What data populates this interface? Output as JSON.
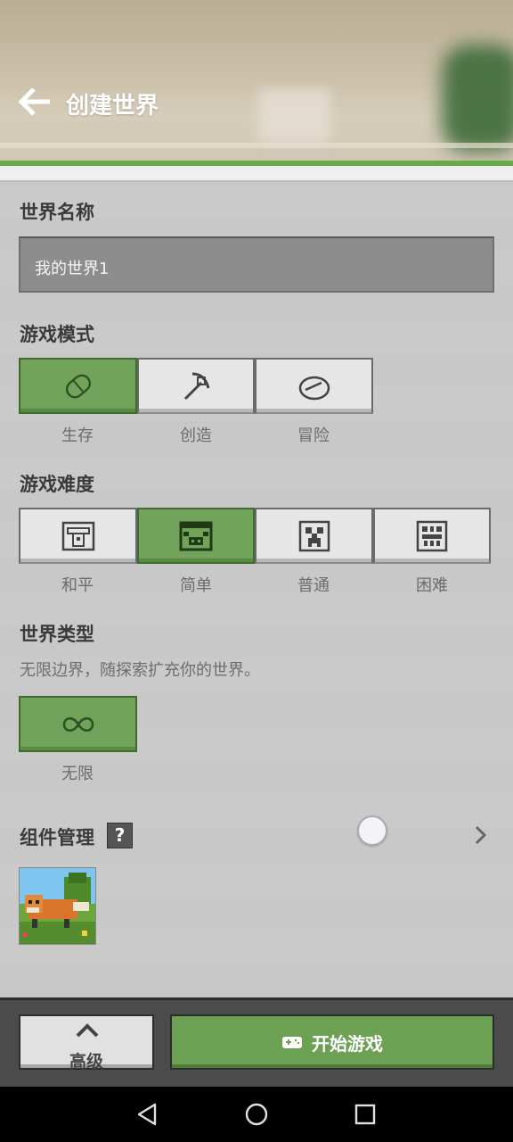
{
  "header": {
    "title": "创建世界",
    "back_icon": "back-arrow-icon"
  },
  "world_name": {
    "label": "世界名称",
    "value": "我的世界1"
  },
  "game_mode": {
    "label": "游戏模式",
    "options": [
      {
        "label": "生存",
        "icon": "survival-icon",
        "selected": true
      },
      {
        "label": "创造",
        "icon": "pickaxe-icon",
        "selected": false
      },
      {
        "label": "冒险",
        "icon": "compass-icon",
        "selected": false
      }
    ]
  },
  "difficulty": {
    "label": "游戏难度",
    "options": [
      {
        "label": "和平",
        "icon": "peaceful-icon",
        "selected": false
      },
      {
        "label": "简单",
        "icon": "pig-icon",
        "selected": true
      },
      {
        "label": "普通",
        "icon": "creeper-icon",
        "selected": false
      },
      {
        "label": "困难",
        "icon": "ghast-icon",
        "selected": false
      }
    ]
  },
  "world_type": {
    "label": "世界类型",
    "description": "无限边界，随探索扩充你的世界。",
    "options": [
      {
        "label": "无限",
        "icon": "infinity-icon",
        "selected": true
      }
    ]
  },
  "addons": {
    "label": "组件管理",
    "help": "?"
  },
  "footer": {
    "advanced_label": "高级",
    "play_label": "开始游戏"
  },
  "colors": {
    "accent": "#71a45a",
    "accent_dark": "#3f6b2e",
    "panel": "#c8c8c8"
  }
}
